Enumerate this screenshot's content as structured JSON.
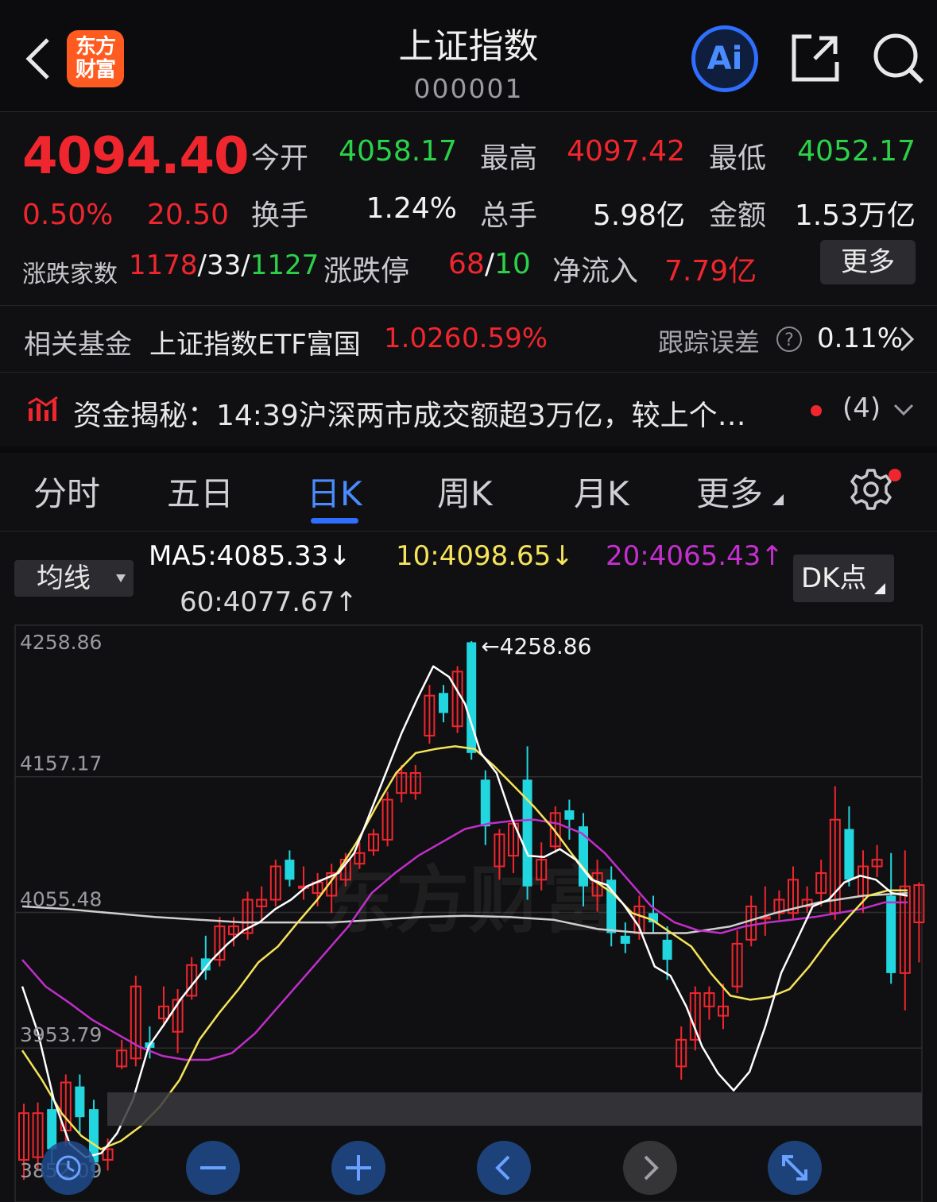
{
  "header": {
    "title": "上证指数",
    "code": "000001",
    "logo_line1": "东方",
    "logo_line2": "财富",
    "ai_label": "Ai"
  },
  "quote": {
    "price": "4094.40",
    "change_pct": "0.50%",
    "change": "20.50",
    "open_label": "今开",
    "open": "4058.17",
    "high_label": "最高",
    "high": "4097.42",
    "low_label": "最低",
    "low": "4052.17",
    "turnover_label": "换手",
    "turnover": "1.24%",
    "volume_label": "总手",
    "volume": "5.98亿",
    "amount_label": "金额",
    "amount": "1.53万亿",
    "breadth_label": "涨跌家数",
    "breadth_up": "1178",
    "breadth_flat": "33",
    "breadth_down": "1127",
    "limit_label": "涨跌停",
    "limit_up": "68",
    "limit_down": "10",
    "netflow_label": "净流入",
    "netflow": "7.79亿",
    "more_label": "更多"
  },
  "fund": {
    "label": "相关基金",
    "name": "上证指数ETF富国",
    "price": "1.026",
    "pct": "0.59%",
    "tracking_label": "跟踪误差",
    "tracking_value": "0.11%"
  },
  "news": {
    "text": "资金揭秘：14:39沪深两市成交额超3万亿，较上个…",
    "count": "(4)"
  },
  "tabs": [
    {
      "label": "分时"
    },
    {
      "label": "五日"
    },
    {
      "label": "日K"
    },
    {
      "label": "周K"
    },
    {
      "label": "月K"
    },
    {
      "label": "更多"
    }
  ],
  "ma": {
    "select_label": "均线",
    "ma5": "MA5:4085.33↓",
    "ma10": "10:4098.65↓",
    "ma20": "20:4065.43↑",
    "ma60": "60:4077.67↑",
    "dk_label": "DK点"
  },
  "colors": {
    "up": "#f0262e",
    "down": "#2cd14a",
    "candle_down": "#22d6e0",
    "ma5": "#ffffff",
    "ma10": "#f5e35a",
    "ma20": "#c02fc9",
    "ma60": "#cfcfcf",
    "accent": "#2f6fff"
  },
  "chart_data": {
    "type": "candlestick",
    "y_ticks": [
      "4258.86",
      "4157.17",
      "4055.48",
      "3953.79",
      "3852.09"
    ],
    "ylim": [
      3852.09,
      4258.86
    ],
    "max_label": "4258.86",
    "watermark": "东方财富",
    "candles": [
      {
        "o": 3870,
        "c": 3905,
        "h": 3912,
        "l": 3855
      },
      {
        "o": 3872,
        "c": 3905,
        "h": 3913,
        "l": 3862
      },
      {
        "o": 3908,
        "c": 3878,
        "h": 3922,
        "l": 3866
      },
      {
        "o": 3892,
        "c": 3928,
        "h": 3934,
        "l": 3880
      },
      {
        "o": 3925,
        "c": 3902,
        "h": 3934,
        "l": 3890
      },
      {
        "o": 3908,
        "c": 3868,
        "h": 3915,
        "l": 3858
      },
      {
        "o": 3870,
        "c": 3878,
        "h": 3886,
        "l": 3862
      },
      {
        "o": 3940,
        "c": 3952,
        "h": 3960,
        "l": 3938
      },
      {
        "o": 3946,
        "c": 4000,
        "h": 4008,
        "l": 3940
      },
      {
        "o": 3958,
        "c": 3954,
        "h": 3970,
        "l": 3946
      },
      {
        "o": 3976,
        "c": 3985,
        "h": 4000,
        "l": 3970
      },
      {
        "o": 3966,
        "c": 3990,
        "h": 3998,
        "l": 3950
      },
      {
        "o": 3993,
        "c": 4016,
        "h": 4022,
        "l": 3990
      },
      {
        "o": 4021,
        "c": 4012,
        "h": 4038,
        "l": 4005
      },
      {
        "o": 4020,
        "c": 4045,
        "h": 4052,
        "l": 4015
      },
      {
        "o": 4039,
        "c": 4045,
        "h": 4052,
        "l": 4030
      },
      {
        "o": 4040,
        "c": 4065,
        "h": 4071,
        "l": 4035
      },
      {
        "o": 4060,
        "c": 4065,
        "h": 4075,
        "l": 4050
      },
      {
        "o": 4065,
        "c": 4090,
        "h": 4095,
        "l": 4060
      },
      {
        "o": 4095,
        "c": 4080,
        "h": 4102,
        "l": 4075
      },
      {
        "o": 4075,
        "c": 4075,
        "h": 4090,
        "l": 4065
      },
      {
        "o": 4070,
        "c": 4078,
        "h": 4085,
        "l": 4060
      },
      {
        "o": 4068,
        "c": 4085,
        "h": 4092,
        "l": 4055
      },
      {
        "o": 4080,
        "c": 4095,
        "h": 4100,
        "l": 4075
      },
      {
        "o": 4092,
        "c": 4100,
        "h": 4108,
        "l": 4088
      },
      {
        "o": 4102,
        "c": 4114,
        "h": 4118,
        "l": 4098
      },
      {
        "o": 4110,
        "c": 4140,
        "h": 4146,
        "l": 4105
      },
      {
        "o": 4145,
        "c": 4160,
        "h": 4166,
        "l": 4138
      },
      {
        "o": 4145,
        "c": 4160,
        "h": 4166,
        "l": 4140
      },
      {
        "o": 4188,
        "c": 4218,
        "h": 4226,
        "l": 4182
      },
      {
        "o": 4220,
        "c": 4205,
        "h": 4226,
        "l": 4198
      },
      {
        "o": 4195,
        "c": 4236,
        "h": 4240,
        "l": 4190
      },
      {
        "o": 4258,
        "c": 4175,
        "h": 4258.86,
        "l": 4170
      },
      {
        "o": 4155,
        "c": 4120,
        "h": 4162,
        "l": 4106
      },
      {
        "o": 4090,
        "c": 4114,
        "h": 4118,
        "l": 4080
      },
      {
        "o": 4098,
        "c": 4122,
        "h": 4125,
        "l": 4085
      },
      {
        "o": 4155,
        "c": 4075,
        "h": 4180,
        "l": 4065
      },
      {
        "o": 4080,
        "c": 4095,
        "h": 4108,
        "l": 4072
      },
      {
        "o": 4105,
        "c": 4130,
        "h": 4135,
        "l": 4100
      },
      {
        "o": 4132,
        "c": 4125,
        "h": 4140,
        "l": 4110
      },
      {
        "o": 4120,
        "c": 4075,
        "h": 4130,
        "l": 4060
      },
      {
        "o": 4068,
        "c": 4085,
        "h": 4095,
        "l": 4056
      },
      {
        "o": 4080,
        "c": 4040,
        "h": 4090,
        "l": 4030
      },
      {
        "o": 4038,
        "c": 4032,
        "h": 4048,
        "l": 4025
      },
      {
        "o": 4040,
        "c": 4060,
        "h": 4068,
        "l": 4035
      },
      {
        "o": 4055,
        "c": 4048,
        "h": 4068,
        "l": 4040
      },
      {
        "o": 4035,
        "c": 4020,
        "h": 4045,
        "l": 4005
      },
      {
        "o": 3940,
        "c": 3960,
        "h": 3970,
        "l": 3930
      },
      {
        "o": 3960,
        "c": 3995,
        "h": 4000,
        "l": 3952
      },
      {
        "o": 3985,
        "c": 3995,
        "h": 4000,
        "l": 3975
      },
      {
        "o": 3978,
        "c": 3985,
        "h": 4002,
        "l": 3968
      },
      {
        "o": 4000,
        "c": 4032,
        "h": 4042,
        "l": 3995
      },
      {
        "o": 4035,
        "c": 4060,
        "h": 4068,
        "l": 4030
      },
      {
        "o": 4052,
        "c": 4052,
        "h": 4075,
        "l": 4038
      },
      {
        "o": 4055,
        "c": 4065,
        "h": 4072,
        "l": 4050
      },
      {
        "o": 4055,
        "c": 4080,
        "h": 4090,
        "l": 4050
      },
      {
        "o": 4060,
        "c": 4065,
        "h": 4075,
        "l": 4055
      },
      {
        "o": 4070,
        "c": 4085,
        "h": 4095,
        "l": 4060
      },
      {
        "o": 4055,
        "c": 4125,
        "h": 4150,
        "l": 4050
      },
      {
        "o": 4118,
        "c": 4080,
        "h": 4135,
        "l": 4075
      },
      {
        "o": 4068,
        "c": 4090,
        "h": 4102,
        "l": 4055
      },
      {
        "o": 4090,
        "c": 4095,
        "h": 4106,
        "l": 4082
      },
      {
        "o": 4068,
        "c": 4010,
        "h": 4100,
        "l": 4002
      },
      {
        "o": 4010,
        "c": 4075,
        "h": 4102,
        "l": 3982
      },
      {
        "o": 4048,
        "c": 4076,
        "h": 4078,
        "l": 4018
      }
    ],
    "ma5": [
      4000,
      3965,
      3915,
      3882,
      3872,
      3875,
      3890,
      3915,
      3955,
      3972,
      3990,
      4005,
      4020,
      4032,
      4042,
      4048,
      4058,
      4065,
      4075,
      4080,
      4085,
      4100,
      4130,
      4160,
      4190,
      4216,
      4240,
      4232,
      4212,
      4175,
      4160,
      4125,
      4098,
      4097,
      4103,
      4095,
      4080,
      4076,
      4062,
      4045,
      4015,
      4008,
      3985,
      3955,
      3935,
      3922,
      3936,
      3970,
      4010,
      4035,
      4060,
      4065,
      4078,
      4083,
      4080,
      4070,
      4068
    ],
    "ma10": [
      3952,
      3930,
      3905,
      3888,
      3878,
      3884,
      3895,
      3910,
      3930,
      3960,
      3980,
      3998,
      4018,
      4030,
      4048,
      4065,
      4085,
      4108,
      4135,
      4160,
      4175,
      4178,
      4180,
      4178,
      4165,
      4150,
      4135,
      4118,
      4098,
      4080,
      4070,
      4055,
      4050,
      4040,
      4030,
      4010,
      3993,
      3990,
      3992,
      3998,
      4015,
      4035,
      4052,
      4068,
      4072,
      4072
    ],
    "ma20": [
      4020,
      4000,
      3988,
      3975,
      3965,
      3955,
      3948,
      3945,
      3945,
      3950,
      3965,
      3985,
      4005,
      4025,
      4045,
      4070,
      4085,
      4098,
      4108,
      4118,
      4122,
      4124,
      4125,
      4122,
      4115,
      4100,
      4080,
      4060,
      4048,
      4042,
      4040,
      4045,
      4048,
      4050,
      4052,
      4055,
      4058,
      4063,
      4063
    ],
    "ma60": [
      4060,
      4058,
      4055,
      4052,
      4050,
      4048,
      4048,
      4048,
      4050,
      4052,
      4053,
      4052,
      4050,
      4043,
      4040,
      4040,
      4045,
      4055,
      4063,
      4068,
      4070
    ]
  },
  "nav_buttons": [
    "history-icon",
    "zoom-out-icon",
    "zoom-in-icon",
    "left-icon",
    "right-icon",
    "fullscreen-icon"
  ]
}
